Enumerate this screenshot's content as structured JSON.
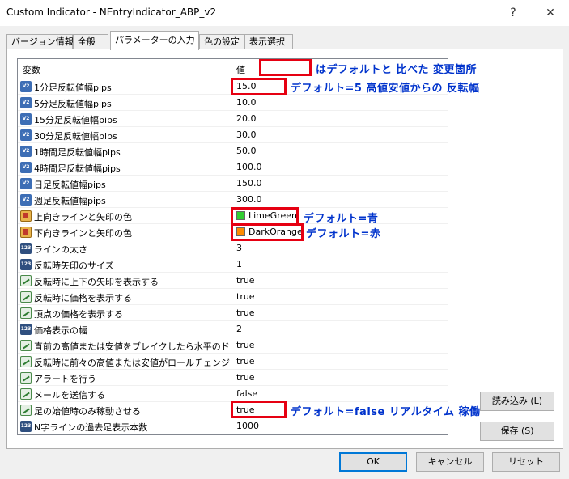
{
  "window": {
    "title": "Custom Indicator - NEntryIndicator_ABP_v2",
    "help_glyph": "?",
    "close_glyph": "✕"
  },
  "tabs": [
    {
      "label": "バージョン情報"
    },
    {
      "label": "全般"
    },
    {
      "label": "パラメーターの入力"
    },
    {
      "label": "色の設定"
    },
    {
      "label": "表示選択"
    }
  ],
  "grid": {
    "header": {
      "variable": "変数",
      "value": "値"
    },
    "rows": [
      {
        "icon": "num-icon",
        "name": "1分足反転値幅pips",
        "value": "15.0"
      },
      {
        "icon": "num-icon",
        "name": "5分足反転値幅pips",
        "value": "10.0"
      },
      {
        "icon": "num-icon",
        "name": "15分足反転値幅pips",
        "value": "20.0"
      },
      {
        "icon": "num-icon",
        "name": "30分足反転値幅pips",
        "value": "30.0"
      },
      {
        "icon": "num-icon",
        "name": "1時間足反転値幅pips",
        "value": "50.0"
      },
      {
        "icon": "num-icon",
        "name": "4時間足反転値幅pips",
        "value": "100.0"
      },
      {
        "icon": "num-icon",
        "name": "日足反転値幅pips",
        "value": "150.0"
      },
      {
        "icon": "num-icon",
        "name": "週足反転値幅pips",
        "value": "300.0"
      },
      {
        "icon": "color-icon",
        "name": "上向きラインと矢印の色",
        "value": "LimeGreen",
        "swatch": "#32cd32"
      },
      {
        "icon": "color-icon",
        "name": "下向きラインと矢印の色",
        "value": "DarkOrange",
        "swatch": "#ff8c00"
      },
      {
        "icon": "int-icon",
        "name": "ラインの太さ",
        "value": "3"
      },
      {
        "icon": "int-icon",
        "name": "反転時矢印のサイズ",
        "value": "1"
      },
      {
        "icon": "bool-icon",
        "name": "反転時に上下の矢印を表示する",
        "value": "true"
      },
      {
        "icon": "bool-icon",
        "name": "反転時に価格を表示する",
        "value": "true"
      },
      {
        "icon": "bool-icon",
        "name": "頂点の価格を表示する",
        "value": "true"
      },
      {
        "icon": "int-icon",
        "name": "価格表示の幅",
        "value": "2"
      },
      {
        "icon": "bool-icon",
        "name": "直前の高値または安値をブレイクしたら水平のドッ...",
        "value": "true"
      },
      {
        "icon": "bool-icon",
        "name": "反転時に前々の高値または安値がロールチェンジ...",
        "value": "true"
      },
      {
        "icon": "bool-icon",
        "name": "アラートを行う",
        "value": "true"
      },
      {
        "icon": "bool-icon",
        "name": "メールを送信する",
        "value": "false"
      },
      {
        "icon": "bool-icon",
        "name": "足の始値時のみ稼動させる",
        "value": "true"
      },
      {
        "icon": "int-icon",
        "name": "N字ラインの過去足表示本数",
        "value": "1000"
      }
    ]
  },
  "buttons": {
    "load": "読み込み (L)",
    "save": "保存 (S)",
    "ok": "OK",
    "cancel": "キャンセル",
    "reset": "リセット"
  },
  "annotations": {
    "legend": "はデフォルトと 比べた 変更箇所",
    "row1": "デフォルト=5 高値安値からの 反転幅",
    "up_color": "デフォルト=青",
    "down_color": "デフォルト=赤",
    "bar_open": "デフォルト=false リアルタイム 稼働"
  },
  "colors": {
    "highlight": "#e60012",
    "annotation_text": "#0033cc",
    "primary_border": "#0078d7"
  }
}
